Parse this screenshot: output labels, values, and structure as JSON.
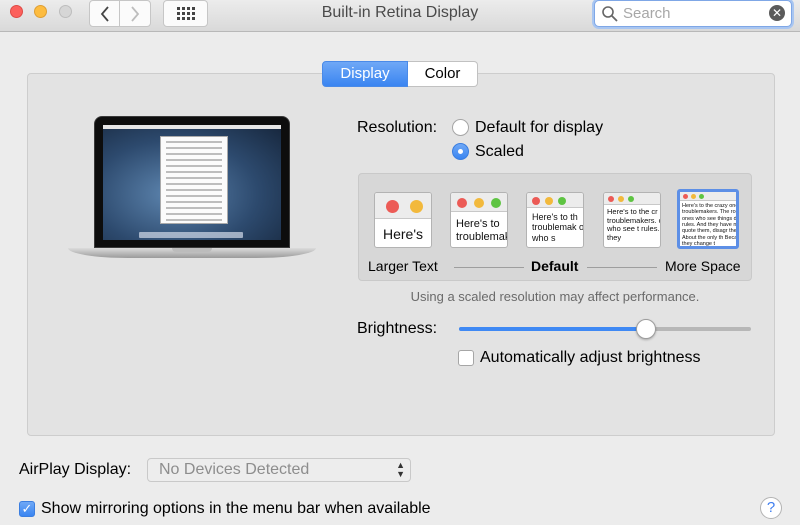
{
  "window": {
    "title": "Built-in Retina Display"
  },
  "search": {
    "placeholder": "Search",
    "value": ""
  },
  "tabs": [
    {
      "label": "Display",
      "selected": true
    },
    {
      "label": "Color",
      "selected": false
    }
  ],
  "resolution": {
    "label": "Resolution:",
    "options": [
      {
        "label": "Default for display",
        "selected": false
      },
      {
        "label": "Scaled",
        "selected": true
      }
    ],
    "scales": [
      {
        "preview_text": "Here's"
      },
      {
        "preview_text": "Here's to troublemak"
      },
      {
        "preview_text": "Here's to th troublemak ones who s"
      },
      {
        "preview_text": "Here's to the cr troublemakers. ones who see t rules. And they"
      },
      {
        "preview_text": "Here's to the crazy one troublemakers. The rou ones who see things dif rules. And they have no can quote them, disagr them. About the only th Because they change t"
      }
    ],
    "selected_scale_index": 4,
    "scale_labels": {
      "left": "Larger Text",
      "middle": "Default",
      "right": "More Space"
    },
    "note": "Using a scaled resolution may affect performance."
  },
  "brightness": {
    "label": "Brightness:",
    "level": 0.64,
    "auto_label": "Automatically adjust brightness",
    "auto_checked": false
  },
  "airplay": {
    "label": "AirPlay Display:",
    "value": "No Devices Detected"
  },
  "mirroring": {
    "label": "Show mirroring options in the menu bar when available",
    "checked": true
  },
  "help": {
    "label": "?"
  },
  "colors": {
    "accent": "#3f89f4",
    "red": "#ec5b56",
    "yellow": "#f2b93c",
    "green": "#5ec442"
  },
  "icons": {
    "back": "chevron-left-icon",
    "forward": "chevron-right-icon",
    "grid": "grid-icon",
    "search": "search-icon",
    "clear": "clear-icon"
  }
}
